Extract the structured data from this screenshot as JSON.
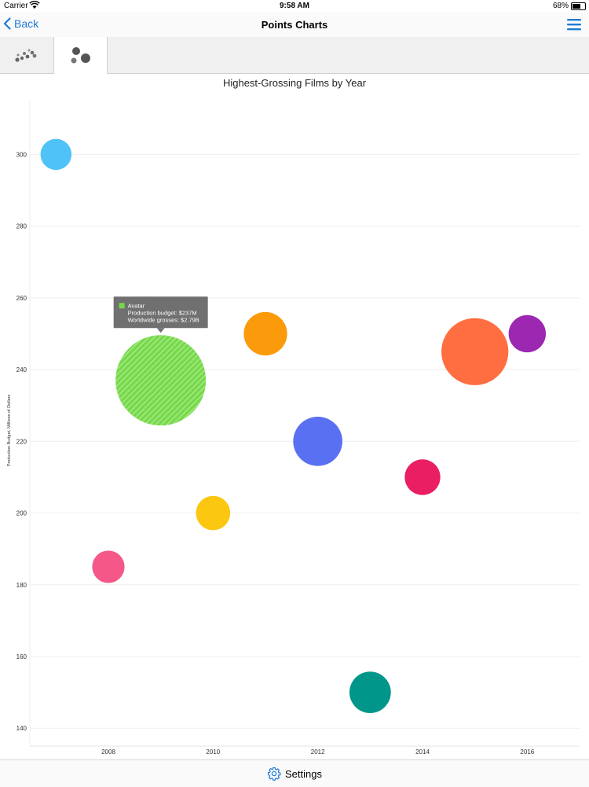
{
  "status_bar": {
    "carrier": "Carrier",
    "time": "9:58 AM",
    "battery": "68%"
  },
  "nav": {
    "back_label": "Back",
    "title": "Points Charts"
  },
  "tabs": [
    {
      "icon": "scatter-chart-icon",
      "selected": false
    },
    {
      "icon": "bubble-chart-icon",
      "selected": true
    }
  ],
  "bottom": {
    "settings_label": "Settings"
  },
  "colors": {
    "accent": "#1e7bd6"
  },
  "chart_data": {
    "type": "scatter",
    "title": "Highest-Grossing Films by Year",
    "ylabel": "Production Budget, Millions of Dollars",
    "xlabel": "",
    "xlim": [
      2006.5,
      2017
    ],
    "ylim": [
      135,
      315
    ],
    "x_ticks": [
      2008,
      2010,
      2012,
      2014,
      2016
    ],
    "y_ticks": [
      140,
      160,
      180,
      200,
      220,
      240,
      260,
      280,
      300
    ],
    "grid": true,
    "points": [
      {
        "name": "",
        "x": 2007,
        "y": 300,
        "size": 0.96,
        "color": "#4fc3f7"
      },
      {
        "name": "",
        "x": 2008,
        "y": 185,
        "size": 1.0,
        "color": "#f55788"
      },
      {
        "name": "Avatar",
        "x": 2009,
        "y": 237,
        "size": 2.79,
        "color": "#76d94a",
        "highlighted": true
      },
      {
        "name": "",
        "x": 2010,
        "y": 200,
        "size": 1.06,
        "color": "#fbc711"
      },
      {
        "name": "",
        "x": 2011,
        "y": 250,
        "size": 1.34,
        "color": "#fb9a0a"
      },
      {
        "name": "",
        "x": 2012,
        "y": 220,
        "size": 1.52,
        "color": "#5a70f2"
      },
      {
        "name": "",
        "x": 2013,
        "y": 150,
        "size": 1.28,
        "color": "#00968a"
      },
      {
        "name": "",
        "x": 2014,
        "y": 210,
        "size": 1.1,
        "color": "#e91e63"
      },
      {
        "name": "",
        "x": 2015,
        "y": 245,
        "size": 2.07,
        "color": "#ff6e40"
      },
      {
        "name": "",
        "x": 2016,
        "y": 250,
        "size": 1.15,
        "color": "#9c27b0"
      }
    ],
    "tooltip": {
      "name": "Avatar",
      "line1": "Production budget: $237M",
      "line2": "Worldwide grosses: $2.79B",
      "swatch_color": "#76d94a"
    }
  }
}
